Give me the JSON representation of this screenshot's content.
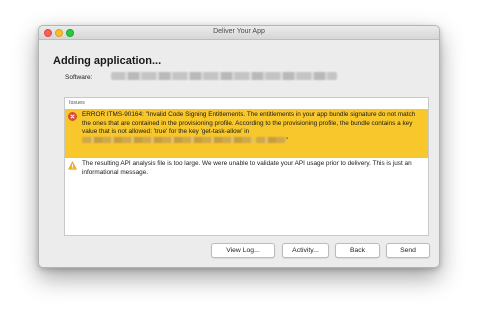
{
  "window": {
    "title": "Deliver Your App"
  },
  "main": {
    "heading": "Adding application...",
    "software_label": "Software:",
    "software_value": "redacted"
  },
  "issues": {
    "header": "Issues",
    "error": {
      "icon": "error-icon",
      "text_before": "ERROR ITMS-90164: \"Invalid Code Signing Entitlements. The entitlements in your app bundle signature do not match the ones that are contained in the provisioning profile. According to the provisioning profile, the bundle contains a key value that is not allowed: 'true' for the key 'get-task-allow' in",
      "redacted_1": "redacted",
      "redacted_2": "redacted",
      "text_after": "\""
    },
    "warning": {
      "icon": "warning-icon",
      "text": "The resulting API analysis file is too large.  We were unable to validate your API usage prior to delivery.  This is just an informational message."
    }
  },
  "buttons": {
    "view_log": "View Log...",
    "activity": "Activity...",
    "back": "Back",
    "send": "Send"
  },
  "colors": {
    "error_highlight": "#f7c72b",
    "close": "#fc5f57",
    "minimize": "#fdbc2e",
    "maximize": "#28c840"
  }
}
